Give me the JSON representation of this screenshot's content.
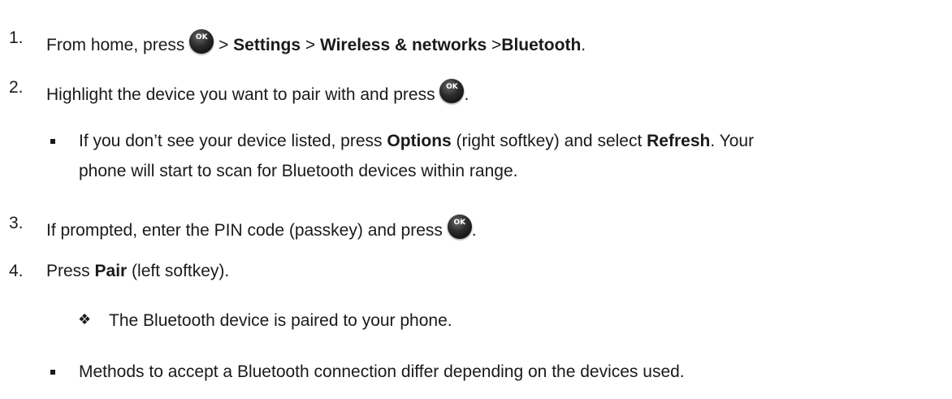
{
  "steps": {
    "s1": {
      "num": "1.",
      "pre": "From home, press",
      "sep1": " > ",
      "b1": "Settings",
      "sep2": " > ",
      "b2": "Wireless & networks",
      "sep3": " >",
      "b3": "Bluetooth",
      "end": "."
    },
    "s2": {
      "num": "2.",
      "text": "Highlight the device you want to pair with and press",
      "end": "."
    },
    "sub1": {
      "line1_pre": "If you don’t see your device listed, press ",
      "line1_b1": "Options",
      "line1_mid": " (right softkey) and select ",
      "line1_b2": "Refresh",
      "line1_end": ". Your",
      "line2": "phone will start to scan for Bluetooth devices within range."
    },
    "s3": {
      "num": "3.",
      "text": "If prompted, enter the PIN code (passkey) and press",
      "end": "."
    },
    "s4": {
      "num": "4.",
      "pre": "Press ",
      "b": "Pair",
      "post": " (left softkey)."
    },
    "result": {
      "bullet": "❖",
      "text": "The Bluetooth device is paired to your phone."
    },
    "note": {
      "text": "Methods to accept a Bluetooth connection differ depending on the devices used."
    }
  },
  "icons": {
    "ok_label": "OK",
    "ok_icon": "ok-button-icon"
  }
}
